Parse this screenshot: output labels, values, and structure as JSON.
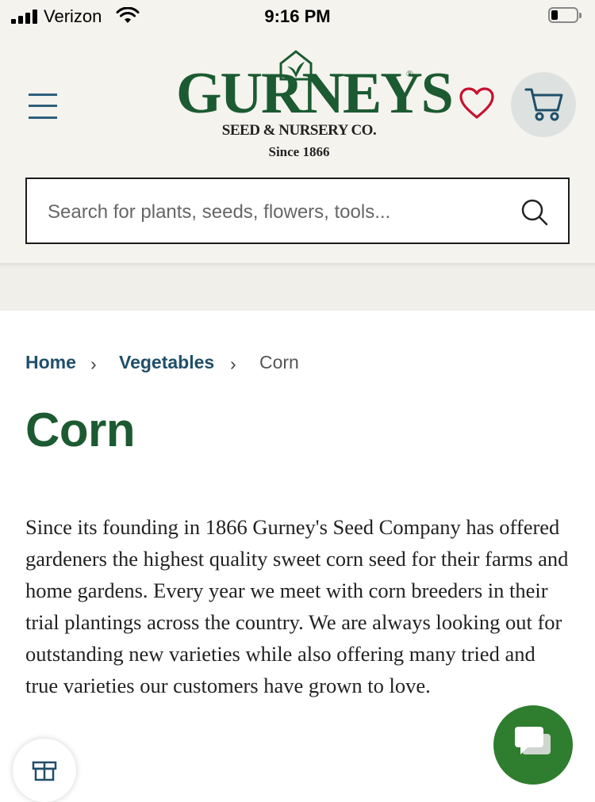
{
  "status_bar": {
    "carrier": "Verizon",
    "time": "9:16 PM"
  },
  "header": {
    "logo": {
      "brand": "GURNEYS",
      "registered_mark": "®",
      "subtitle": "SEED & NURSERY CO.",
      "since": "Since 1866"
    },
    "search": {
      "placeholder": "Search for plants, seeds, flowers, tools..."
    }
  },
  "breadcrumb": {
    "items": [
      {
        "label": "Home"
      },
      {
        "label": "Vegetables"
      },
      {
        "label": "Corn"
      }
    ],
    "separator": "›"
  },
  "page": {
    "title": "Corn",
    "description": "Since its founding in 1866 Gurney's Seed Company has offered gardeners the highest quality sweet corn seed for their farms and home gardens. Every year we meet with corn breeders in their trial plantings across the country. We are always looking out for outstanding new varieties while also offering many tried and true varieties our customers have grown to love."
  },
  "colors": {
    "brand_green": "#1c5a31",
    "link_blue": "#1f4f6a",
    "header_bg": "#f4f3ee",
    "heart_red": "#c8102e",
    "chat_green": "#2f7d2e"
  },
  "icons": [
    "signal-icon",
    "wifi-icon",
    "battery-icon",
    "menu-icon",
    "heart-icon",
    "cart-icon",
    "search-icon",
    "chevron-right-icon",
    "chat-icon",
    "gift-icon"
  ]
}
